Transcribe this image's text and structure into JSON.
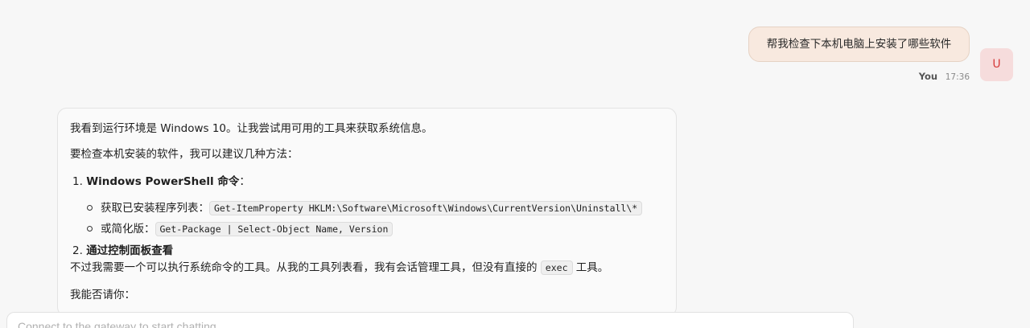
{
  "user_message": {
    "text": "帮我检查下本机电脑上安装了哪些软件",
    "sender": "You",
    "time": "17:36",
    "avatar_letter": "U"
  },
  "assistant_message": {
    "p1": "我看到运行环境是 Windows 10。让我尝试用可用的工具来获取系统信息。",
    "p2": "要检查本机安装的软件，我可以建议几种方法：",
    "item1_num": "1.",
    "item1_title": "Windows PowerShell 命令",
    "item1_colon": "：",
    "bullet1_label": "获取已安装程序列表：",
    "bullet1_code": "Get-ItemProperty HKLM:\\Software\\Microsoft\\Windows\\CurrentVersion\\Uninstall\\*",
    "bullet2_label": "或简化版：",
    "bullet2_code": "Get-Package | Select-Object Name, Version",
    "item2_num": "2.",
    "item2_title": "通过控制面板查看",
    "p3_before": "不过我需要一个可以执行系统命令的工具。从我的工具列表看，我有会话管理工具，但没有直接的",
    "p3_code": "exec",
    "p3_after": "工具。",
    "p4": "我能否请你："
  },
  "input": {
    "placeholder": "Connect to the gateway to start chatting..."
  },
  "colors": {
    "user_bubble": "#f8e9df",
    "avatar_bg": "#f6dcdc",
    "avatar_text": "#d63c3c"
  }
}
